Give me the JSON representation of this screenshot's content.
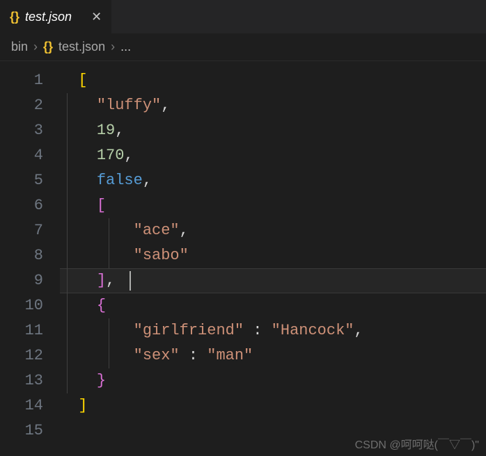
{
  "tab": {
    "filename": "test.json",
    "icon": "{}"
  },
  "breadcrumb": {
    "folder": "bin",
    "file": "test.json",
    "icon": "{}",
    "ellipsis": "..."
  },
  "editor": {
    "lines": [
      {
        "n": "1",
        "indent": 0,
        "tokens": [
          {
            "t": "[",
            "c": "brace"
          }
        ]
      },
      {
        "n": "2",
        "indent": 1,
        "tokens": [
          {
            "t": "\"luffy\"",
            "c": "str"
          },
          {
            "t": ",",
            "c": "punc"
          }
        ]
      },
      {
        "n": "3",
        "indent": 1,
        "tokens": [
          {
            "t": "19",
            "c": "num"
          },
          {
            "t": ",",
            "c": "punc"
          }
        ]
      },
      {
        "n": "4",
        "indent": 1,
        "tokens": [
          {
            "t": "170",
            "c": "num"
          },
          {
            "t": ",",
            "c": "punc"
          }
        ]
      },
      {
        "n": "5",
        "indent": 1,
        "tokens": [
          {
            "t": "false",
            "c": "bool"
          },
          {
            "t": ",",
            "c": "punc"
          }
        ]
      },
      {
        "n": "6",
        "indent": 1,
        "tokens": [
          {
            "t": "[",
            "c": "brace-purple"
          }
        ]
      },
      {
        "n": "7",
        "indent": 2,
        "tokens": [
          {
            "t": "\"ace\"",
            "c": "str"
          },
          {
            "t": ",",
            "c": "punc"
          }
        ]
      },
      {
        "n": "8",
        "indent": 2,
        "tokens": [
          {
            "t": "\"sabo\"",
            "c": "str"
          }
        ]
      },
      {
        "n": "9",
        "indent": 1,
        "tokens": [
          {
            "t": "]",
            "c": "brace-purple"
          },
          {
            "t": ",",
            "c": "punc"
          }
        ]
      },
      {
        "n": "10",
        "indent": 1,
        "tokens": [
          {
            "t": "{",
            "c": "brace-purple"
          }
        ]
      },
      {
        "n": "11",
        "indent": 2,
        "tokens": [
          {
            "t": "\"girlfriend\"",
            "c": "str"
          },
          {
            "t": " : ",
            "c": "punc"
          },
          {
            "t": "\"Hancock\"",
            "c": "str"
          },
          {
            "t": ",",
            "c": "punc"
          }
        ]
      },
      {
        "n": "12",
        "indent": 2,
        "tokens": [
          {
            "t": "\"sex\"",
            "c": "str"
          },
          {
            "t": " : ",
            "c": "punc"
          },
          {
            "t": "\"man\"",
            "c": "str"
          }
        ]
      },
      {
        "n": "13",
        "indent": 1,
        "tokens": [
          {
            "t": "}",
            "c": "brace-purple"
          }
        ]
      },
      {
        "n": "14",
        "indent": 0,
        "tokens": [
          {
            "t": "]",
            "c": "brace"
          }
        ]
      },
      {
        "n": "15",
        "indent": 0,
        "tokens": []
      }
    ],
    "active_line": 9
  },
  "watermark": "CSDN @呵呵哒(￣▽￣)\""
}
